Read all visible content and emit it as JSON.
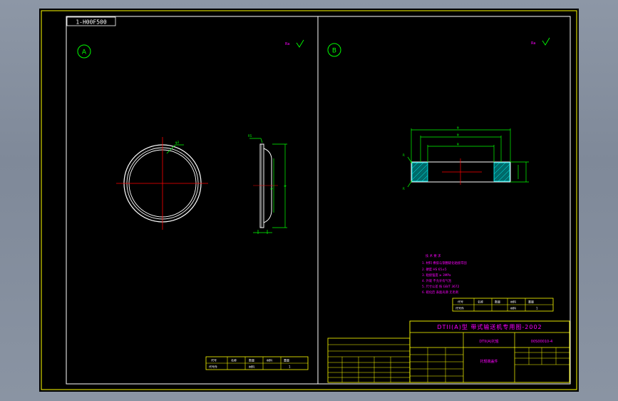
{
  "drawing": {
    "code_tag": "1-H00F500",
    "view_a_label": "A",
    "view_b_label": "B",
    "roughness_a": "Ra",
    "roughness_b": "Ra",
    "title_main": "DTII(A)型 带式输送机专用图-2002",
    "part_name": "DTII(A)托辊",
    "part_code": "00S00010-4",
    "part_sub": "托辊端盖件"
  },
  "small_table_a": {
    "row1": [
      "代号",
      "名称",
      "数量",
      "材料",
      "重量"
    ],
    "row2": [
      "代号件",
      "",
      "材料",
      "",
      "1"
    ]
  },
  "small_table_b": {
    "row1": [
      "代号",
      "名称",
      "数量",
      "材料",
      "重量"
    ],
    "row2": [
      "代号件",
      "",
      "材料",
      "",
      "1"
    ]
  },
  "notes": [
    "技 术 要 求",
    "1. 材料 橡胶与钢圈硫化粘接牢固",
    "2. 硬度 HS 65±5",
    "3. 粘接强度 ≥ 3MPa",
    "4. 外观 不允许有气泡",
    "5. 尺寸公差 按 GB/T 3672",
    "6. 硫化后 表面光滑 无毛刺"
  ],
  "colors": {
    "frame": "#ffff00",
    "geometry": "#ffffff",
    "dimension": "#00ff00",
    "center": "#ff0000",
    "text": "#ff00ff",
    "hatch": "#00ffff"
  }
}
